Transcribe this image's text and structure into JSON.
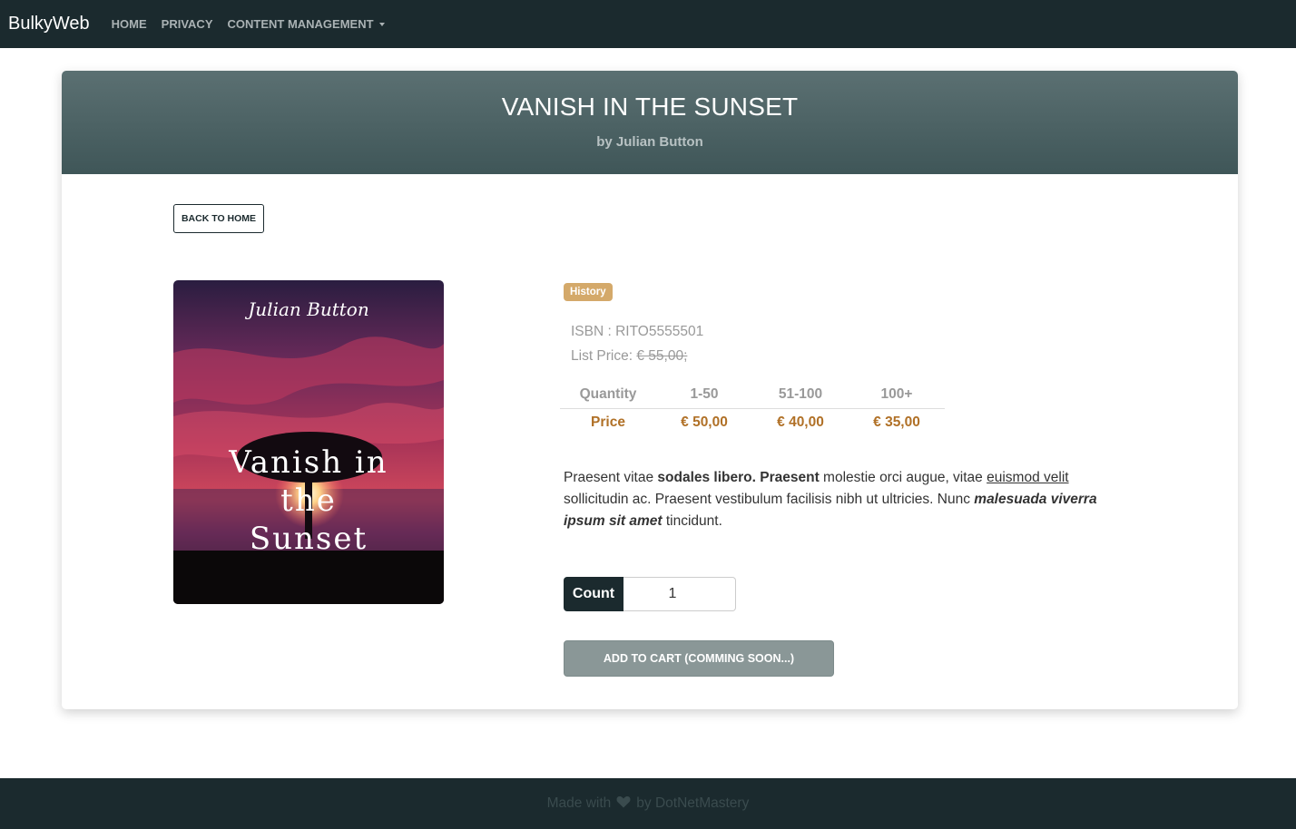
{
  "nav": {
    "brand": "BulkyWeb",
    "items": [
      {
        "label": "HOME"
      },
      {
        "label": "PRIVACY"
      },
      {
        "label": "CONTENT MANAGEMENT"
      }
    ]
  },
  "product": {
    "title": "VANISH IN THE SUNSET",
    "author_line": "by Julian Button",
    "back_label": "BACK TO HOME",
    "cover": {
      "author": "Julian Button",
      "title_lines": [
        "Vanish in",
        "the",
        "Sunset"
      ]
    },
    "category": "History",
    "isbn_label": "ISBN : ",
    "isbn": "RITO5555501",
    "list_price_label": "List Price: ",
    "list_price": "€ 55,00;",
    "tiers": {
      "quantity_label": "Quantity",
      "ranges": [
        "1-50",
        "51-100",
        "100+"
      ],
      "price_label": "Price",
      "prices": [
        "€ 50,00",
        "€ 40,00",
        "€ 35,00"
      ]
    },
    "description": {
      "t1": "Praesent vitae ",
      "b1": "sodales libero. Praesent",
      "t2": " molestie orci augue, vitae ",
      "u1": "euismod velit",
      "t3": " sollicitudin ac. Praesent vestibulum facilisis nibh ut ultricies. Nunc ",
      "bi1": "malesuada viverra ipsum sit amet",
      "t4": " tincidunt."
    },
    "count_label": "Count",
    "count_value": "1",
    "cart_label": "ADD TO CART (COMMING SOON...)"
  },
  "footer": {
    "text_before": "Made with",
    "text_after": "by DotNetMastery"
  },
  "colors": {
    "navbar": "#1b2a2e",
    "header_gradient_top": "#5b7072",
    "header_gradient_bottom": "#3f5658",
    "badge": "#d4a96a",
    "price": "#b07026",
    "cart_button": "#8a9797"
  }
}
